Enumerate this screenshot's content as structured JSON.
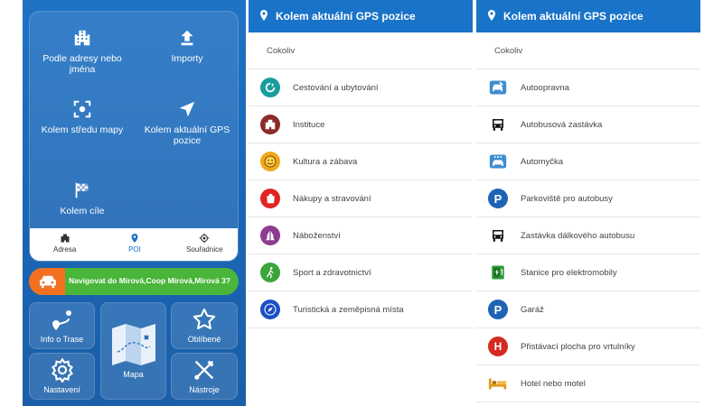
{
  "panel1": {
    "grid": [
      {
        "label": "Podle adresy nebo jména",
        "icon": "building-icon"
      },
      {
        "label": "Importy",
        "icon": "upload-icon"
      },
      {
        "label": "Kolem středu mapy",
        "icon": "map-center-icon"
      },
      {
        "label": "Kolem aktuální GPS pozice",
        "icon": "navigation-arrow-icon"
      },
      {
        "label": "Kolem cíle",
        "icon": "checkered-flag-icon"
      }
    ],
    "tabs": [
      {
        "label": "Adresa",
        "icon": "building-icon"
      },
      {
        "label": "POI",
        "icon": "map-pin-icon",
        "active": true
      },
      {
        "label": "Souřadnice",
        "icon": "crosshair-icon"
      }
    ],
    "navigate_label": "Navigovat do Mírová,Coop Mírová,Mírová 3?",
    "tiles": {
      "route_info": "Info o Trase",
      "map": "Mapa",
      "favorites": "Oblíbené",
      "settings": "Nastavení",
      "tools": "Nástroje"
    }
  },
  "panel2": {
    "title": "Kolem aktuální GPS pozice",
    "any_label": "Cokoliv",
    "items": [
      {
        "label": "Cestování a ubytování",
        "icon": "travel-icon",
        "color": "#1a9c9c"
      },
      {
        "label": "Instituce",
        "icon": "institution-icon",
        "color": "#8b2b2b"
      },
      {
        "label": "Kultura a zábava",
        "icon": "smiley-icon",
        "color": "#f2a71b"
      },
      {
        "label": "Nákupy a stravování",
        "icon": "shopping-bag-icon",
        "color": "#e02424"
      },
      {
        "label": "Náboženství",
        "icon": "praying-hands-icon",
        "color": "#8e3a8e"
      },
      {
        "label": "Sport a zdravotnictví",
        "icon": "runner-icon",
        "color": "#3aa53a"
      },
      {
        "label": "Turistická a zeměpisná místa",
        "icon": "compass-icon",
        "color": "#1a4fc4"
      }
    ]
  },
  "panel3": {
    "title": "Kolem aktuální GPS pozice",
    "any_label": "Cokoliv",
    "items": [
      {
        "label": "Autoopravna",
        "icon": "car-repair-icon"
      },
      {
        "label": "Autobusová zastávka",
        "icon": "bus-icon"
      },
      {
        "label": "Automyčka",
        "icon": "car-wash-icon"
      },
      {
        "label": "Parkoviště pro autobusy",
        "icon": "bus-parking-icon"
      },
      {
        "label": "Zastávka dálkového autobusu",
        "icon": "coach-icon"
      },
      {
        "label": "Stanice pro elektromobily",
        "icon": "ev-charging-icon"
      },
      {
        "label": "Garáž",
        "icon": "garage-icon"
      },
      {
        "label": "Přistávací plocha pro vrtulníky",
        "icon": "helipad-icon"
      },
      {
        "label": "Hotel nebo motel",
        "icon": "bed-icon"
      }
    ]
  }
}
